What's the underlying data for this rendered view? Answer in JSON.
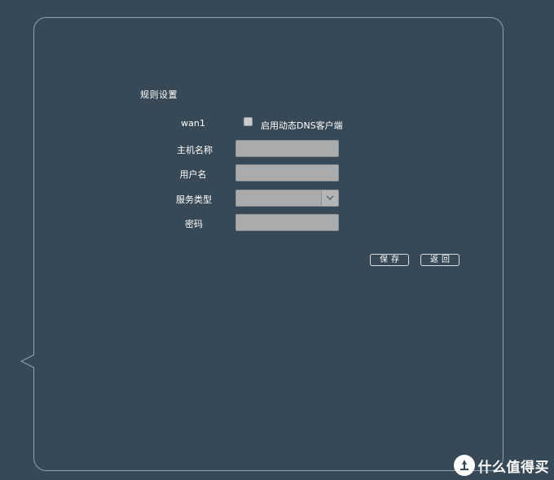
{
  "form": {
    "section_title": "规则设置",
    "wan_label": "wan1",
    "ddns_checkbox_label": "启用动态DNS客户端",
    "ddns_checked": false,
    "hostname_label": "主机名称",
    "hostname_value": "",
    "username_label": "用户名",
    "username_value": "",
    "service_type_label": "服务类型",
    "service_type_value": "",
    "password_label": "密码",
    "password_value": ""
  },
  "buttons": {
    "save_label": "保存",
    "back_label": "返回"
  },
  "watermark": {
    "logo": "值",
    "text": "什么值得买"
  },
  "colors": {
    "background": "#374957",
    "panel_border": "#8fa3b5",
    "input_bg": "#a9abad"
  },
  "icons": [
    "checkbox-icon",
    "chevron-down-icon"
  ]
}
